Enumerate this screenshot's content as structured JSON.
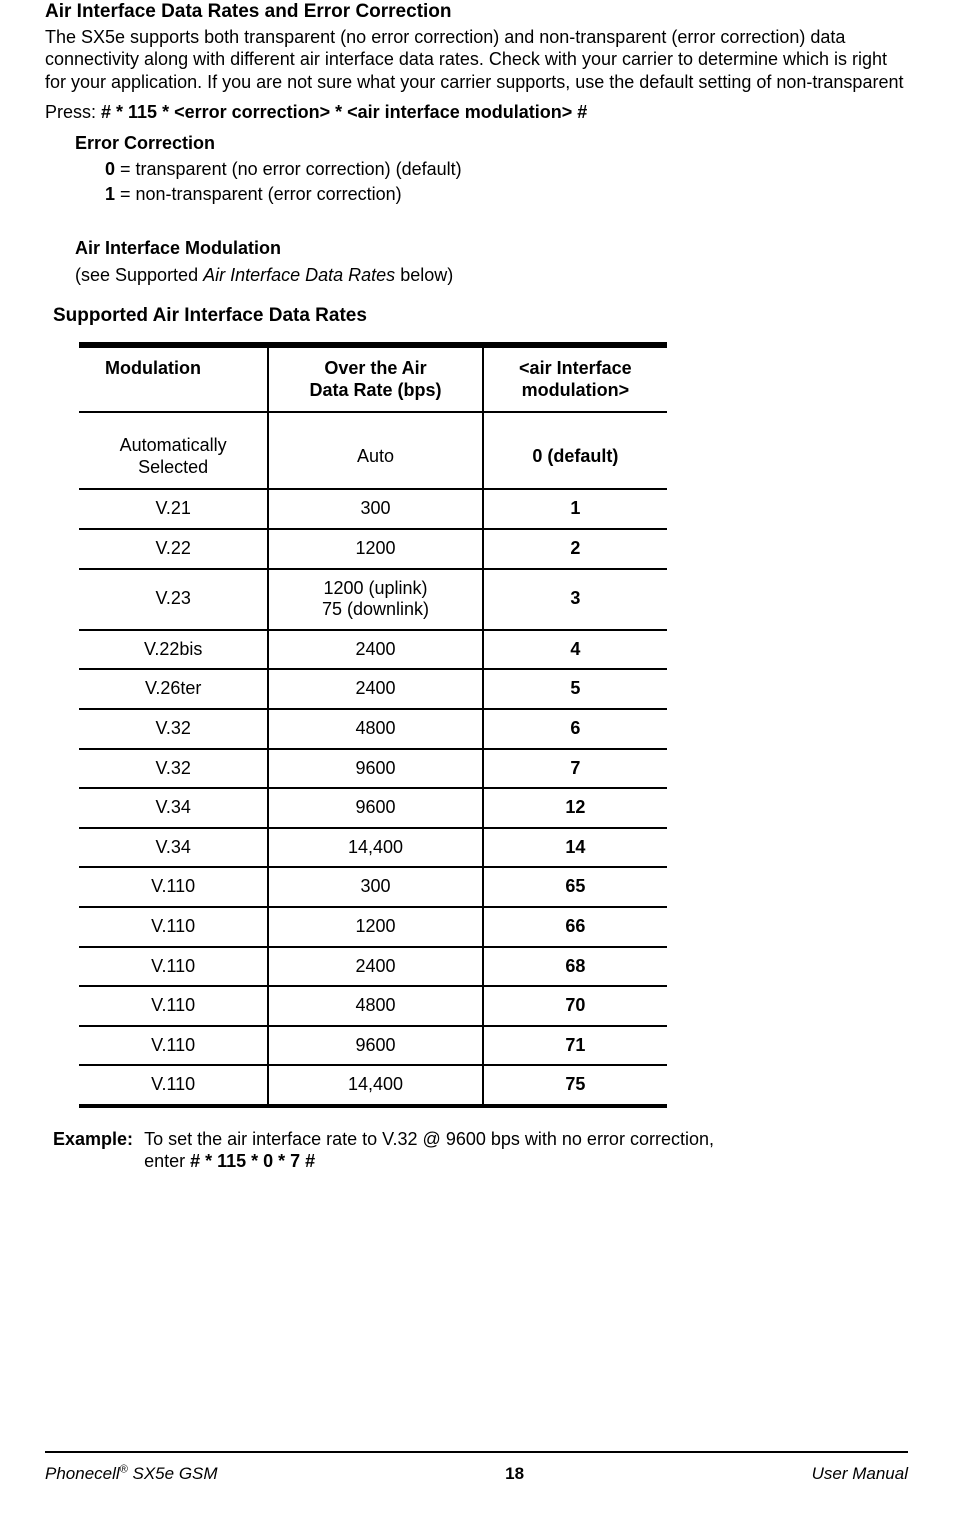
{
  "section": {
    "title": "Air Interface Data Rates and Error Correction",
    "intro": "The SX5e supports both transparent (no error correction) and non-transparent (error correction) data connectivity along with different air interface data rates.  Check with your carrier to determine which is right for your application.  If you are not sure what your carrier supports, use the default setting of non-transparent",
    "press_label": "Press:  ",
    "press_cmd": "#  *  115  *  <error correction>  *  <air interface modulation>  #",
    "ec_heading": "Error Correction",
    "ec_opts": [
      {
        "key": "0",
        "text": " = transparent (no error correction) (default)"
      },
      {
        "key": "1",
        "text": " = non-transparent (error correction)"
      }
    ],
    "aim_heading": "Air Interface Modulation",
    "aim_see_pre": "(see Supported ",
    "aim_see_ital": "Air Interface Data Rates",
    "aim_see_post": " below)",
    "table_title": "Supported Air Interface Data Rates",
    "headers": {
      "c1": "Modulation",
      "c2a": "Over the Air",
      "c2b": "Data Rate (bps)",
      "c3a": "<air Interface",
      "c3b": "modulation>"
    },
    "rows": [
      {
        "c1a": "Automatically",
        "c1b": "Selected",
        "c2": "Auto",
        "c3": "0 (default)",
        "tall": true
      },
      {
        "c1": "V.21",
        "c2": "300",
        "c3": "1"
      },
      {
        "c1": "V.22",
        "c2": "1200",
        "c3": "2"
      },
      {
        "c1": "V.23",
        "c2a": "1200 (uplink)",
        "c2b": "75 (downlink)",
        "c3": "3"
      },
      {
        "c1": "V.22bis",
        "c2": "2400",
        "c3": "4"
      },
      {
        "c1": "V.26ter",
        "c2": "2400",
        "c3": "5"
      },
      {
        "c1": "V.32",
        "c2": "4800",
        "c3": "6"
      },
      {
        "c1": "V.32",
        "c2": "9600",
        "c3": "7"
      },
      {
        "c1": "V.34",
        "c2": "9600",
        "c3": "12"
      },
      {
        "c1": "V.34",
        "c2": "14,400",
        "c3": "14"
      },
      {
        "c1": "V.110",
        "c2": "300",
        "c3": "65"
      },
      {
        "c1": "V.110",
        "c2": "1200",
        "c3": "66"
      },
      {
        "c1": "V.110",
        "c2": "2400",
        "c3": "68"
      },
      {
        "c1": "V.110",
        "c2": "4800",
        "c3": "70"
      },
      {
        "c1": "V.110",
        "c2": "9600",
        "c3": "71"
      },
      {
        "c1": "V.110",
        "c2": "14,400",
        "c3": "75",
        "last": true
      }
    ],
    "example_label": "Example:",
    "example_line1": "To set the air interface rate to V.32 @ 9600 bps with no error correction,",
    "example_line2_pre": "enter  ",
    "example_line2_cmd": "#  *  115  *  0  *  7  #"
  },
  "footer": {
    "left_pre": "Phonecell",
    "left_sup": "®",
    "left_post": " SX5e GSM",
    "center": "18",
    "right": "User Manual"
  }
}
